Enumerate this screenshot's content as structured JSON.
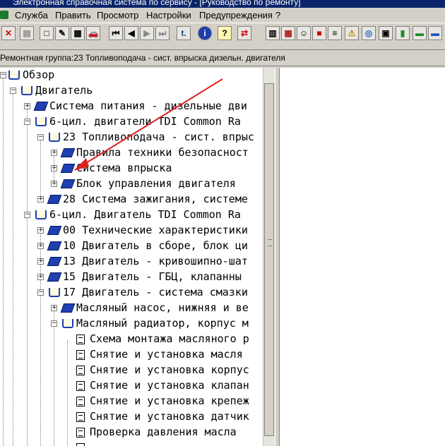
{
  "window": {
    "title": "Электронная справочная система по сервису - [Руководство по ремонту]"
  },
  "menu": {
    "items": [
      {
        "label": "Служба"
      },
      {
        "label": "Править"
      },
      {
        "label": "Просмотр"
      },
      {
        "label": "Настройки"
      },
      {
        "label": "Предупреждения"
      },
      {
        "label": "?"
      }
    ]
  },
  "toolbar": {
    "buttons": [
      {
        "icon": "exit-icon",
        "glyph": "✕"
      },
      {
        "icon": "print-icon",
        "glyph": "▤"
      },
      {
        "icon": "new-document-icon",
        "glyph": "□"
      },
      {
        "icon": "edit-document-icon",
        "glyph": "✎"
      },
      {
        "icon": "notes-icon",
        "glyph": "▦"
      },
      {
        "icon": "car-icon",
        "glyph": "🚗"
      },
      {
        "icon": "first-icon",
        "glyph": "⏮"
      },
      {
        "icon": "previous-icon",
        "glyph": "◀"
      },
      {
        "icon": "next-icon",
        "glyph": "▶"
      },
      {
        "icon": "last-icon",
        "glyph": "⏭"
      },
      {
        "icon": "text-icon",
        "glyph": "t."
      },
      {
        "icon": "info-icon",
        "glyph": "i"
      },
      {
        "icon": "help-icon",
        "glyph": "?"
      },
      {
        "icon": "swap-icon",
        "glyph": "⇄"
      },
      {
        "icon": "report-icon",
        "glyph": "▥"
      },
      {
        "icon": "parts-icon",
        "glyph": "▩"
      },
      {
        "icon": "person-icon",
        "glyph": "☺"
      },
      {
        "icon": "book-red-icon",
        "glyph": "■"
      },
      {
        "icon": "list-icon",
        "glyph": "≡"
      },
      {
        "icon": "warning-icon",
        "glyph": "⚠"
      },
      {
        "icon": "globe-icon",
        "glyph": "◎"
      },
      {
        "icon": "save-icon",
        "glyph": "▣"
      },
      {
        "icon": "green-book-icon",
        "glyph": "▮"
      },
      {
        "icon": "car-green-icon",
        "glyph": "▬"
      },
      {
        "icon": "car-blue-icon",
        "glyph": "▬"
      }
    ]
  },
  "path": {
    "label": "Ремонтная группа:23 Топливоподача - сист. впрыска дизельн. двигателя"
  },
  "tree": [
    {
      "label": "Обзор",
      "kind": "open",
      "expander": "−"
    },
    {
      "label": "Двигатель",
      "kind": "open",
      "expander": "−"
    },
    {
      "label": "Система питания - дизельные дви",
      "kind": "closed",
      "expander": "+"
    },
    {
      "label": "6-цил. двигатели TDI Common Ra",
      "kind": "open",
      "expander": "−"
    },
    {
      "label": "23 Топливоподача - сист. впрыс",
      "kind": "open",
      "expander": "−"
    },
    {
      "label": "Правила техники безопасност",
      "kind": "closed",
      "expander": "+"
    },
    {
      "label": "Система впрыска",
      "kind": "closed",
      "expander": "+"
    },
    {
      "label": "Блок управления двигателя",
      "kind": "closed",
      "expander": "+"
    },
    {
      "label": "28 Система зажигания, системе",
      "kind": "closed",
      "expander": "+"
    },
    {
      "label": "6-цил. Двигатель TDI Common Ra",
      "kind": "open",
      "expander": "−"
    },
    {
      "label": "00 Технические характеристики",
      "kind": "closed",
      "expander": "+"
    },
    {
      "label": "10 Двигатель в сборе, блок ци",
      "kind": "closed",
      "expander": "+"
    },
    {
      "label": "13 Двигатель - кривошипно-шат",
      "kind": "closed",
      "expander": "+"
    },
    {
      "label": "15 Двигатель - ГБЦ, клапанны",
      "kind": "closed",
      "expander": "+"
    },
    {
      "label": "17 Двигатель - система смазки",
      "kind": "open",
      "expander": "−"
    },
    {
      "label": "Масляный насос, нижняя и ве",
      "kind": "closed",
      "expander": "+"
    },
    {
      "label": "Масляный радиатор, корпус м",
      "kind": "open",
      "expander": "−"
    },
    {
      "label": "Схема монтажа масляного р",
      "kind": "doc",
      "expander": ""
    },
    {
      "label": "Снятие и установка масля",
      "kind": "doc",
      "expander": ""
    },
    {
      "label": "Снятие и установка корпус",
      "kind": "doc",
      "expander": ""
    },
    {
      "label": "Снятие и установка клапан",
      "kind": "doc",
      "expander": ""
    },
    {
      "label": "Снятие и установка крепеж",
      "kind": "doc",
      "expander": ""
    },
    {
      "label": "Снятие и установка датчик",
      "kind": "doc",
      "expander": ""
    },
    {
      "label": "Проверка давления масла",
      "kind": "doc",
      "expander": ""
    }
  ],
  "annotation": {
    "color": "#e02020"
  }
}
